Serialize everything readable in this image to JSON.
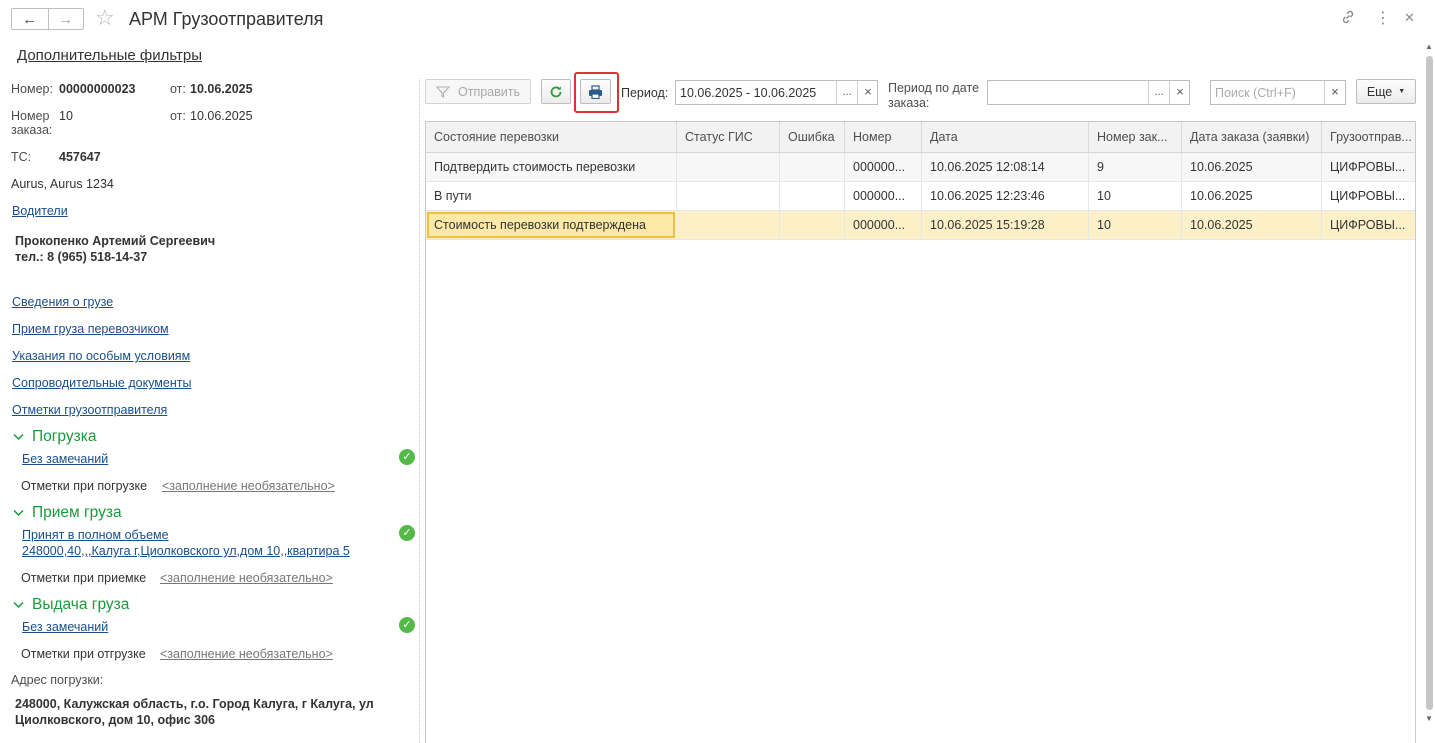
{
  "window": {
    "title": "АРМ Грузоотправителя",
    "back_icon": "←",
    "forward_icon": "→",
    "star_icon": "☆",
    "link_icon": "🔗",
    "more_icon": "⋮",
    "close_icon": "✕"
  },
  "filters_link": "Дополнительные фильтры",
  "left": {
    "number_label": "Номер:",
    "number_value": "00000000023",
    "from_label_1": "от:",
    "from_value_1": "10.06.2025",
    "order_label": "Номер заказа:",
    "order_value": "10",
    "from_label_2": "от:",
    "from_value_2": "10.06.2025",
    "ts_label": "ТС:",
    "ts_value": "457647",
    "vehicle": "Aurus, Aurus 1234",
    "drivers_link": "Водители",
    "driver_name": "Прокопенко Артемий Сергеевич",
    "driver_phone": "тел.: 8 (965) 518-14-37",
    "links": [
      "Сведения о грузе",
      "Прием груза перевозчиком",
      "Указания по особым условиям",
      "Сопроводительные документы",
      "Отметки грузоотправителя"
    ],
    "groups": [
      {
        "title": "Погрузка",
        "status_link": "Без замечаний",
        "status_link_2": "",
        "notes_label": "Отметки при погрузке",
        "notes_value": "<заполнение необязательно>"
      },
      {
        "title": "Прием груза",
        "status_link": "Принят в полном объеме",
        "status_link_2": "248000,40,,,Калуга г,Циолковского ул,дом 10,,квартира 5",
        "notes_label": "Отметки при приемке",
        "notes_value": "<заполнение необязательно>"
      },
      {
        "title": "Выдача груза",
        "status_link": "Без замечаний",
        "status_link_2": "",
        "notes_label": "Отметки при отгрузке",
        "notes_value": "<заполнение необязательно>"
      }
    ],
    "address_label": "Адрес погрузки:",
    "address_value_1": "248000, Калужская область, г.о. Город Калуга, г Калуга, ул",
    "address_value_2": "Циолковского, дом 10, офис 306"
  },
  "toolbar": {
    "send_label": "Отправить",
    "period_label": "Период:",
    "period_value": "10.06.2025 - 10.06.2025",
    "order_period_label_1": "Период по дате",
    "order_period_label_2": "заказа:",
    "order_period_value": "",
    "search_placeholder": "Поиск (Ctrl+F)",
    "more_label": "Еще",
    "ellipsis": "...",
    "clear": "×"
  },
  "table": {
    "columns": [
      "Состояние перевозки",
      "Статус ГИС",
      "Ошибка",
      "Номер",
      "Дата",
      "Номер зак...",
      "Дата заказа (заявки)",
      "Грузоотправ..."
    ],
    "rows": [
      [
        "Подтвердить стоимость перевозки",
        "",
        "",
        "000000...",
        "10.06.2025 12:08:14",
        "9",
        "10.06.2025",
        "ЦИФРОВЫ..."
      ],
      [
        "В пути",
        "",
        "",
        "000000...",
        "10.06.2025 12:23:46",
        "10",
        "10.06.2025",
        "ЦИФРОВЫ..."
      ],
      [
        "Стоимость перевозки подтверждена",
        "",
        "",
        "000000...",
        "10.06.2025 15:19:28",
        "10",
        "10.06.2025",
        "ЦИФРОВЫ..."
      ]
    ]
  },
  "colors": {
    "link": "#1a4f8b",
    "group": "#1a9a3c",
    "check": "#54b948",
    "selected_row": "#fbf0c8",
    "highlight": "#dd3333"
  }
}
